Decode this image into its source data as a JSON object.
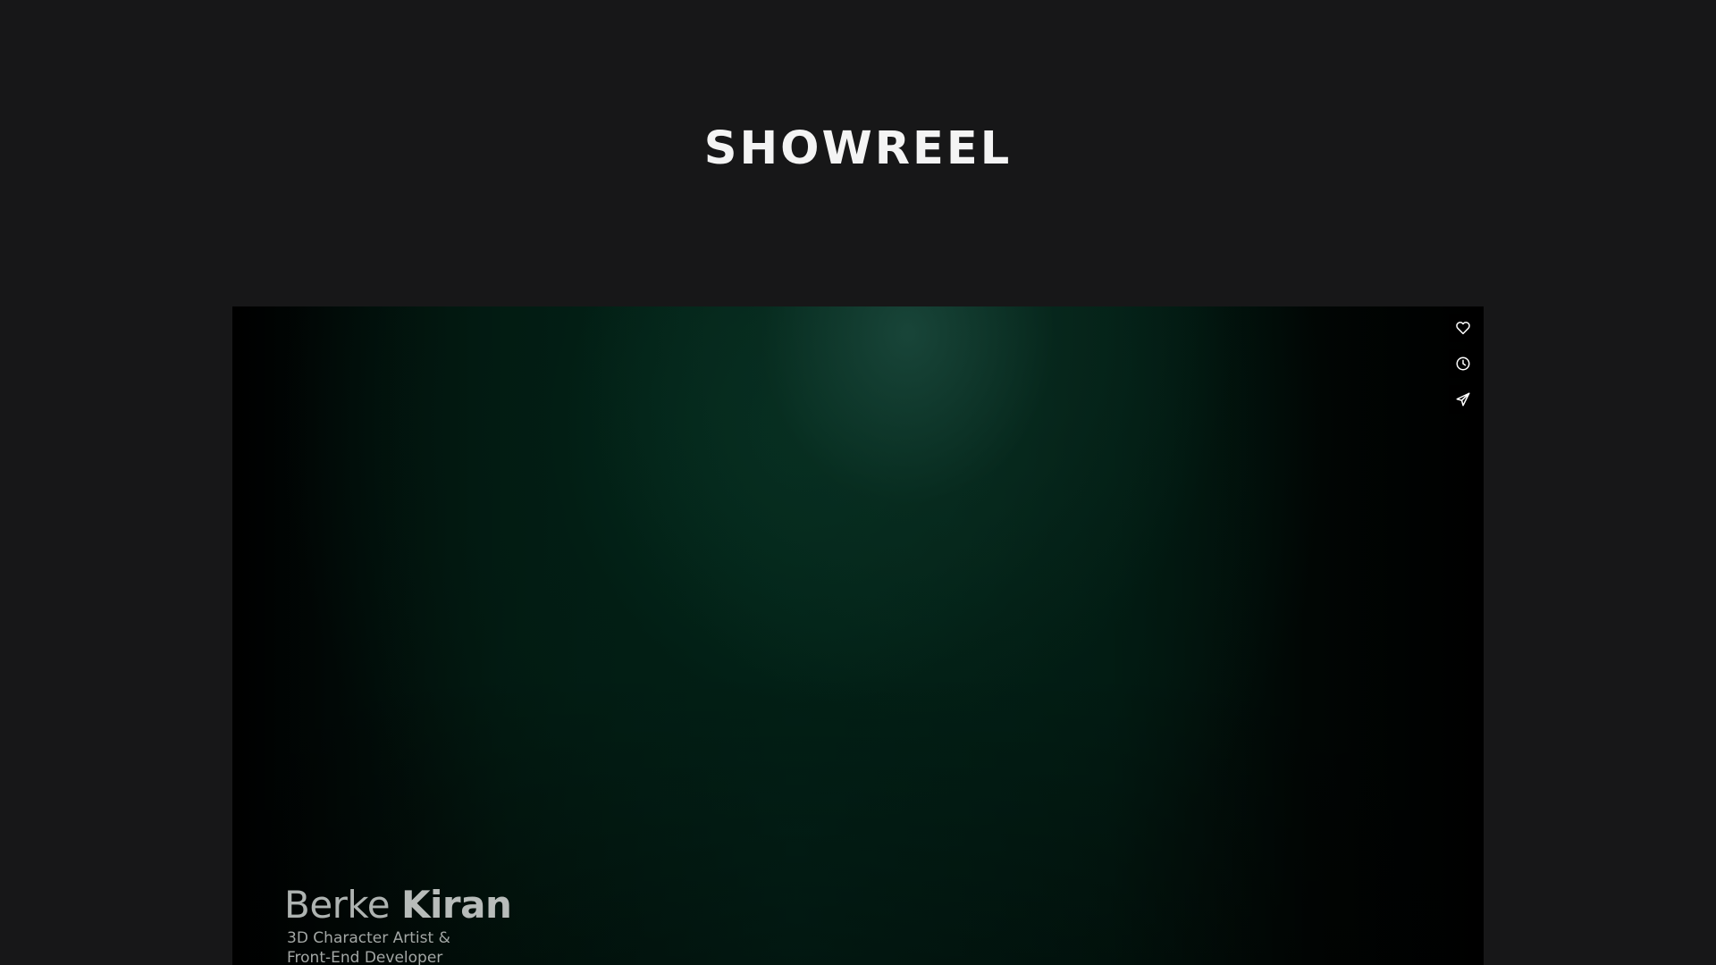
{
  "page": {
    "title": "SHOWREEL"
  },
  "video": {
    "credit": {
      "first_name": "Berke",
      "last_name": "Kiran",
      "role_line1": "3D Character Artist &",
      "role_line2": "Front-End Developer"
    },
    "actions": [
      {
        "name": "like",
        "icon": "heart-icon"
      },
      {
        "name": "watch-later",
        "icon": "clock-icon"
      },
      {
        "name": "share",
        "icon": "paper-plane-icon"
      }
    ]
  },
  "colors": {
    "background": "#171718",
    "title": "#f4f4f4",
    "video_tint": "#03241a",
    "action_bg": "#000000",
    "icon": "#ffffff"
  }
}
